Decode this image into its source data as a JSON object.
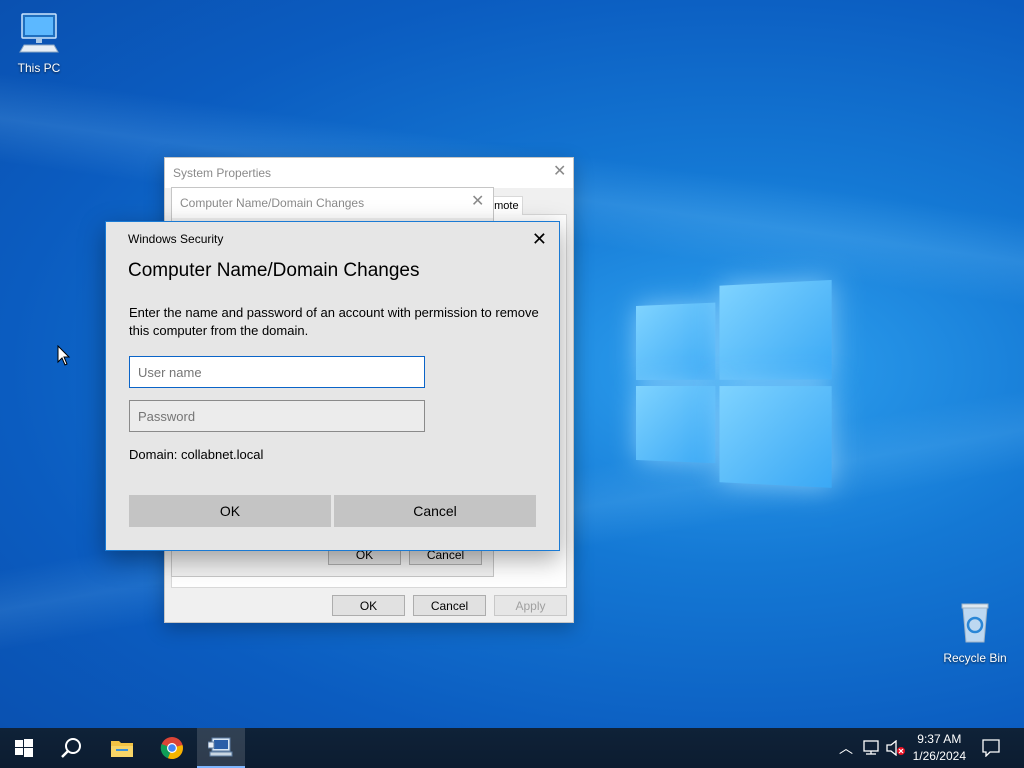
{
  "desktop": {
    "icons": [
      {
        "label": "This PC"
      },
      {
        "label": "Recycle Bin"
      }
    ]
  },
  "system_properties": {
    "title": "System Properties",
    "partial_tab": "emote",
    "buttons": {
      "ok": "OK",
      "cancel": "Cancel",
      "apply": "Apply"
    }
  },
  "name_changes_dialog": {
    "title": "Computer Name/Domain Changes",
    "buttons": {
      "ok": "OK",
      "cancel": "Cancel"
    }
  },
  "security_dialog": {
    "title": "Windows Security",
    "heading": "Computer Name/Domain Changes",
    "description": "Enter the name and password of an account with permission to remove this computer from the domain.",
    "username": {
      "value": "",
      "placeholder": "User name"
    },
    "password": {
      "value": "",
      "placeholder": "Password"
    },
    "domain_text": "Domain: collabnet.local",
    "ok_label": "OK",
    "cancel_label": "Cancel",
    "accent_color": "#1a7ad4"
  },
  "taskbar": {
    "time": "9:37 AM",
    "date": "1/26/2024",
    "background_color": "#0c1c30"
  }
}
